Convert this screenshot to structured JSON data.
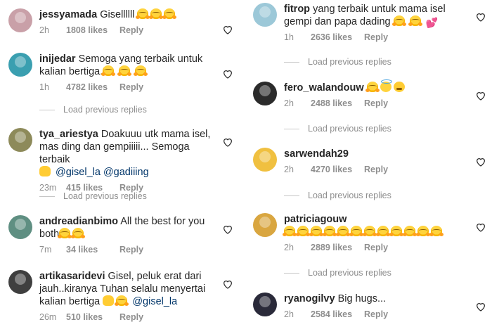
{
  "left": [
    {
      "user": "jessyamada",
      "text": "Gisellllll",
      "emoji_after": [
        "hugging-face",
        "hugging-face",
        "hugging-face"
      ],
      "time": "2h",
      "likes": "1808 likes",
      "reply": "Reply",
      "avatar_color": "#c9a0a8"
    },
    {
      "user": "inijedar",
      "text": "Semoga yang terbaik untuk kalian bertiga.",
      "emoji_after": [
        "hugging-face",
        "hugging-face",
        "hugging-face"
      ],
      "time": "1h",
      "likes": "4782 likes",
      "reply": "Reply",
      "avatar_color": "#3a9fb0",
      "load_previous": "Load previous replies"
    },
    {
      "user": "tya_ariestya",
      "text": "Doakuuu utk mama isel, mas ding dan gempiiiii... Semoga terbaik",
      "emoji_mid": [
        "raising-hands"
      ],
      "mentions": [
        "@gisel_la",
        "@gadiiing"
      ],
      "time": "23m",
      "likes": "415 likes",
      "reply": "Reply",
      "avatar_color": "#8d8a5a",
      "load_previous": "Load previous replies"
    },
    {
      "user": "andreadianbimo",
      "text": "All the best for you both",
      "emoji_after": [
        "hugging-face",
        "hugging-face"
      ],
      "time": "7m",
      "likes": "34 likes",
      "reply": "Reply",
      "avatar_color": "#5f8f82"
    },
    {
      "user": "artikasaridevi",
      "text": "Gisel, peluk erat dari jauh..kiranya Tuhan selalu menyertai kalian bertiga",
      "emoji_after": [
        "raising-hands",
        "hugging-face"
      ],
      "mentions": [
        "@gisel_la"
      ],
      "time": "26m",
      "likes": "510 likes",
      "reply": "Reply",
      "avatar_color": "#3f3f3f"
    }
  ],
  "right": [
    {
      "user": "fitrop",
      "text": "yang terbaik untuk mama isel gempi dan papa dading",
      "emoji_after": [
        "hugging-face",
        "hugging-face",
        "hearts"
      ],
      "time": "1h",
      "likes": "2636 likes",
      "reply": "Reply",
      "avatar_color": "#9cc8d8",
      "load_previous": "Load previous replies"
    },
    {
      "user": "fero_walandouw",
      "text": "",
      "emoji_after": [
        "hugging-face",
        "smiling-halo",
        "weary-face"
      ],
      "time": "2h",
      "likes": "2488 likes",
      "reply": "Reply",
      "avatar_color": "#2b2b2b",
      "load_previous": "Load previous replies"
    },
    {
      "user": "sarwendah29",
      "text": "",
      "time": "2h",
      "likes": "4270 likes",
      "reply": "Reply",
      "avatar_color": "#f0c040",
      "load_previous": "Load previous replies"
    },
    {
      "user": "patriciagouw",
      "text": "",
      "emoji_line": 12,
      "time": "2h",
      "likes": "2889 likes",
      "reply": "Reply",
      "avatar_color": "#d9a640",
      "load_previous": "Load previous replies"
    },
    {
      "user": "ryanogilvy",
      "text": "Big hugs...",
      "time": "2h",
      "likes": "2584 likes",
      "reply": "Reply",
      "avatar_color": "#2a2a3a"
    }
  ]
}
